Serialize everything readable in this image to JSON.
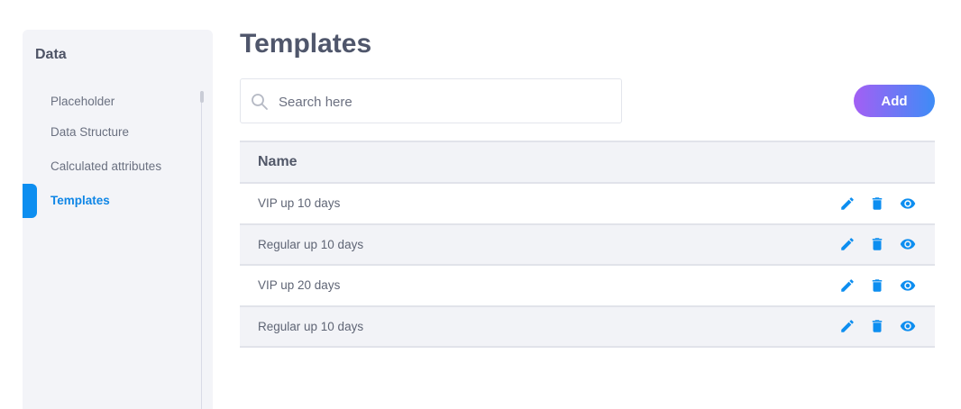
{
  "sidebar": {
    "title": "Data",
    "items": [
      {
        "label": "Placeholder",
        "active": false
      },
      {
        "label": "Data Structure",
        "active": false
      },
      {
        "label": "Calculated attributes",
        "active": false
      },
      {
        "label": "Templates",
        "active": true
      }
    ]
  },
  "page": {
    "title": "Templates"
  },
  "search": {
    "placeholder": "Search here",
    "value": ""
  },
  "toolbar": {
    "add_label": "Add"
  },
  "table": {
    "header": "Name",
    "rows": [
      {
        "name": "VIP up 10 days"
      },
      {
        "name": "Regular up 10 days"
      },
      {
        "name": "VIP up 20 days"
      },
      {
        "name": "Regular up 10 days"
      }
    ]
  },
  "icons": {
    "search": "search-icon",
    "edit": "pencil-icon",
    "delete": "trash-icon",
    "view": "eye-icon"
  },
  "colors": {
    "accent": "#0d8ef0",
    "add_gradient_start": "#a35ff4",
    "add_gradient_end": "#3e8cf6",
    "sidebar_bg": "#f3f4f8",
    "row_alt_bg": "#f2f3f7"
  }
}
